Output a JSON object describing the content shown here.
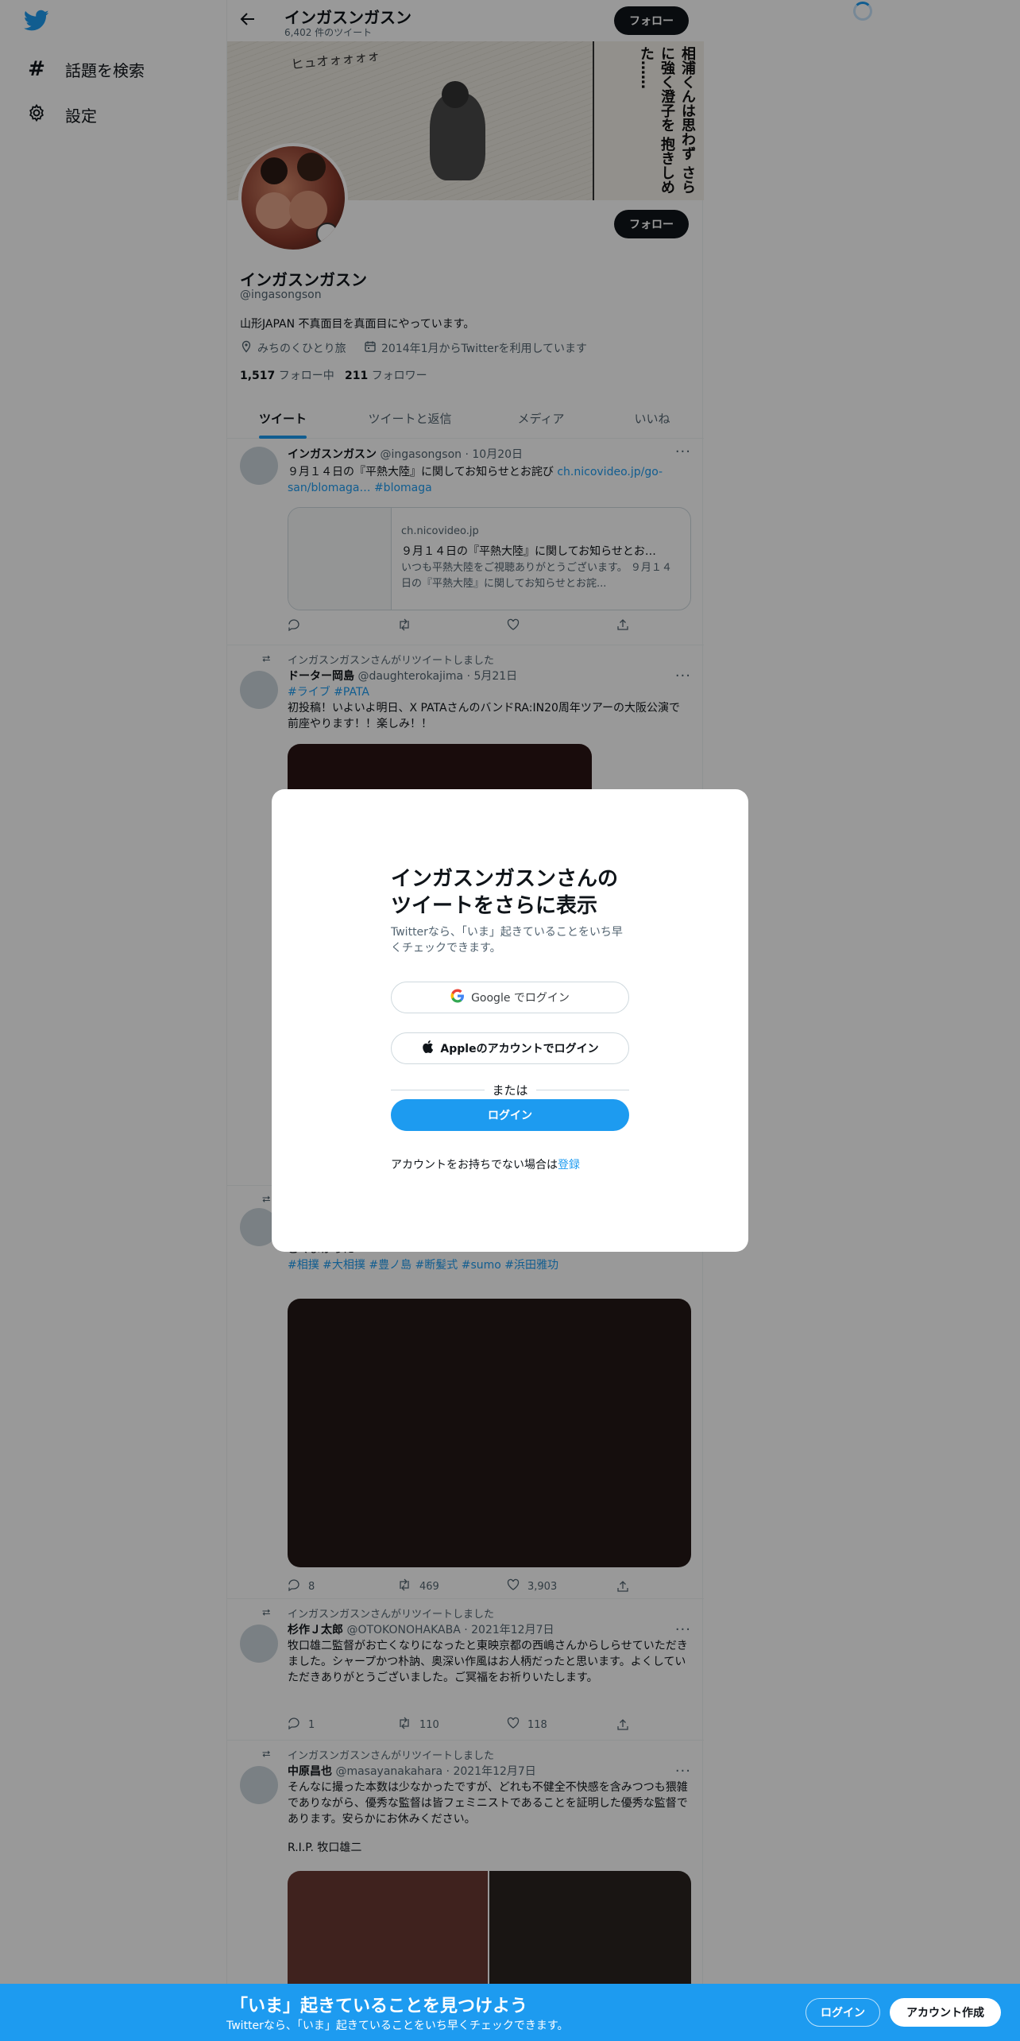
{
  "nav": {
    "explore_label": "話題を検索",
    "settings_label": "設定"
  },
  "header": {
    "name": "インガスンガスン",
    "tweet_count": "6,402 件のツイート",
    "follow_label": "フォロー"
  },
  "banner": {
    "caption_text": "相浦くんは思わず さらに強く澄子を 抱きしめた……",
    "sfx_text": "ヒュオォォォォ"
  },
  "profile": {
    "name": "インガスンガスン",
    "handle": "@ingasongson",
    "follow_label": "フォロー",
    "bio": "山形JAPAN 不真面目を真面目にやっています。",
    "location": "みちのくひとり旅",
    "joined": "2014年1月からTwitterを利用しています",
    "following_count": "1,517",
    "following_label": "フォロー中",
    "followers_count": "211",
    "followers_label": "フォロワー"
  },
  "tabs": [
    {
      "label": "ツイート"
    },
    {
      "label": "ツイートと返信"
    },
    {
      "label": "メディア"
    },
    {
      "label": "いいね"
    }
  ],
  "tweets": [
    {
      "name": "インガスンガスン",
      "handle": "@ingasongson",
      "date": "· 10月20日",
      "text": "９月１４日の『平熱大陸』に関してお知らせとお詫び",
      "link_text": "ch.nicovideo.jp/go-san/blomaga…",
      "hashtag": "#blomaga",
      "card": {
        "domain": "ch.nicovideo.jp",
        "title": "９月１４日の『平熱大陸』に関してお知らせとお…",
        "description": "いつも平熱大陸をご視聴ありがとうございます。 ９月１４日の『平熱大陸』に関してお知らせとお詫..."
      }
    },
    {
      "retweet_label": "インガスンガスンさんがリツイートしました",
      "name": "ドーター岡島",
      "handle": "@daughterokajima",
      "date": "· 5月21日",
      "hashtags": "#ライブ #PATA",
      "text": "初投稿！いよいよ明日、X PATAさんのバンドRA:IN20周年ツアーの大阪公演で前座やります！！楽しみ！！"
    },
    {
      "partial_text": "ごくよかった",
      "hashtags": "#相撲 #大相撲 #豊ノ島 #断髪式 #sumo #浜田雅功",
      "replies": "8",
      "retweets": "469",
      "likes": "3,903"
    },
    {
      "retweet_label": "インガスンガスンさんがリツイートしました",
      "name": "杉作Ｊ太郎",
      "handle": "@OTOKONOHAKABA",
      "date": "· 2021年12月7日",
      "text": "牧口雄二監督がお亡くなりになったと東映京都の西嶋さんからしらせていただきました。シャープかつ朴訥、奥深い作風はお人柄だったと思います。よくしていただきありがとうございました。ご冥福をお祈りいたします。",
      "replies": "1",
      "retweets": "110",
      "likes": "118"
    },
    {
      "retweet_label": "インガスンガスンさんがリツイートしました",
      "name": "中原昌也",
      "handle": "@masayanakahara",
      "date": "· 2021年12月7日",
      "text": "そんなに撮った本数は少なかったですが、どれも不健全不快感を含みつつも猥雑でありながら、優秀な監督は皆フェミニストであることを証明した優秀な監督であります。安らかにお休みください。",
      "text2": "R.I.P. 牧口雄二"
    }
  ],
  "modal": {
    "title": "インガスンガスンさんのツイートをさらに表示",
    "subtitle": "Twitterなら、「いま」起きていることをいち早くチェックできます。",
    "google_label": "Google でログイン",
    "apple_label": "Appleのアカウントでログイン",
    "or_label": "または",
    "login_label": "ログイン",
    "signup_prompt": "アカウントをお持ちでない場合は",
    "signup_link": "登録"
  },
  "bottom_bar": {
    "title": "「いま」起きていることを見つけよう",
    "subtitle": "Twitterなら、「いま」起きていることをいち早くチェックできます。",
    "login_label": "ログイン",
    "signup_label": "アカウント作成"
  },
  "colors": {
    "accent": "#1d9bf0",
    "dark_button": "#0f1419",
    "secondary_text": "#536471"
  }
}
